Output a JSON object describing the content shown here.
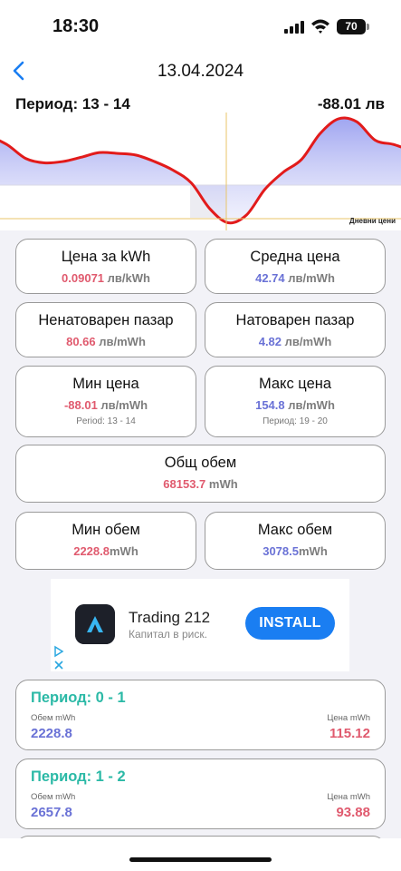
{
  "status": {
    "time": "18:30",
    "battery": "70"
  },
  "header": {
    "title": "13.04.2024"
  },
  "chart": {
    "period_label": "Период: 13 - 14",
    "price_label": "-88.01 лв",
    "legend": "Дневни цени"
  },
  "chart_data": {
    "type": "area",
    "title": "",
    "x": [
      0,
      1,
      2,
      3,
      4,
      5,
      6,
      7,
      8,
      9,
      10,
      11,
      12,
      13,
      14,
      15,
      16,
      17,
      18,
      19,
      20,
      21,
      22,
      23
    ],
    "values": [
      115.12,
      93.88,
      62,
      52,
      55,
      65,
      76,
      74,
      70,
      55,
      35,
      5,
      -55,
      -88.01,
      -70,
      -10,
      30,
      60,
      120,
      154.8,
      148,
      105,
      95,
      80
    ],
    "highlighted_period": "13 - 14",
    "grid": false,
    "colors": {
      "line": "#e21b1b",
      "fill": "#9aa0f0"
    }
  },
  "cards": {
    "price_kwh": {
      "title": "Цена за kWh",
      "value": "0.09071",
      "unit": " лв/kWh"
    },
    "avg_price": {
      "title": "Средна цена",
      "value": "42.74",
      "unit": " лв/mWh"
    },
    "unloaded_market": {
      "title": "Ненатоварен пазар",
      "value": "80.66",
      "unit": " лв/mWh"
    },
    "loaded_market": {
      "title": "Натоварен пазар",
      "value": "4.82",
      "unit": " лв/mWh"
    },
    "min_price": {
      "title": "Мин цена",
      "value": "-88.01",
      "unit": " лв/mWh",
      "sub": "Period: 13 - 14"
    },
    "max_price": {
      "title": "Макс цена",
      "value": "154.8",
      "unit": " лв/mWh",
      "sub": "Период: 19 - 20"
    },
    "total_volume": {
      "title": "Общ обем",
      "value": "68153.7",
      "unit": " mWh"
    },
    "min_volume": {
      "title": "Мин обем",
      "value": "2228.8",
      "unit": "mWh"
    },
    "max_volume": {
      "title": "Макс обем",
      "value": "3078.5",
      "unit": "mWh"
    }
  },
  "ad": {
    "title": "Trading 212",
    "subtitle": "Капитал в риск.",
    "button": "INSTALL",
    "icon": "trading212-logo-icon"
  },
  "periods": [
    {
      "title": "Период: 0 - 1",
      "volume_label": "Обем mWh",
      "price_label": "Цена mWh",
      "volume": "2228.8",
      "price": "115.12"
    },
    {
      "title": "Период: 1 - 2",
      "volume_label": "Обем mWh",
      "price_label": "Цена mWh",
      "volume": "2657.8",
      "price": "93.88"
    }
  ]
}
